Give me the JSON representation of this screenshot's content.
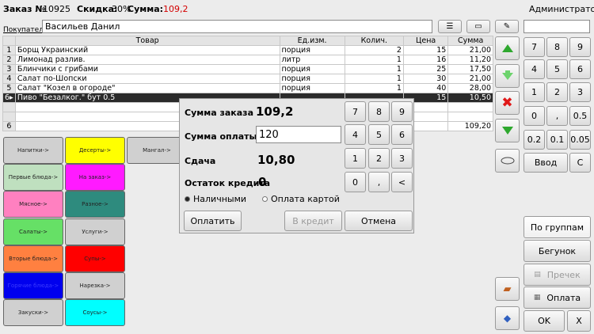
{
  "header": {
    "order_label": "Заказ №",
    "order_no": "10925",
    "discount_label": "Скидка:",
    "discount_value": "30%",
    "sum_label": "Сумма:",
    "sum_value": "109,2",
    "user": "Администратор"
  },
  "buyer": {
    "label": "Покупатель",
    "value": "Васильев Данил"
  },
  "table": {
    "columns": [
      "Товар",
      "Ед.изм.",
      "Колич.",
      "Цена",
      "Сумма"
    ],
    "rows": [
      {
        "n": "1",
        "name": "Борщ Украинский",
        "unit": "порция",
        "qty": "2",
        "price": "15",
        "sum": "21,00"
      },
      {
        "n": "2",
        "name": "Лимонад разлив.",
        "unit": "литр",
        "qty": "1",
        "price": "16",
        "sum": "11,20"
      },
      {
        "n": "3",
        "name": "Блинчики с грибами",
        "unit": "порция",
        "qty": "1",
        "price": "25",
        "sum": "17,50"
      },
      {
        "n": "4",
        "name": "Салат по-Шопски",
        "unit": "порция",
        "qty": "1",
        "price": "30",
        "sum": "21,00"
      },
      {
        "n": "5",
        "name": "Салат \"Козел в огороде\"",
        "unit": "порция",
        "qty": "1",
        "price": "40",
        "sum": "28,00"
      },
      {
        "n": "6",
        "name": "Пиво \"Безалког.\" бут 0.5",
        "unit": "",
        "qty": "",
        "price": "15",
        "sum": "10,50"
      }
    ],
    "footer_count": "6",
    "footer_total": "109,20"
  },
  "categories": [
    {
      "label": "Напитки->",
      "color": "#d0d0d0"
    },
    {
      "label": "Десерты->",
      "color": "#ffff00"
    },
    {
      "label": "Мангал->",
      "color": "#d0d0d0"
    },
    {
      "label": "Первые блюда->",
      "color": "#bfe0bf"
    },
    {
      "label": "На заказ->",
      "color": "#ff1aff"
    },
    {
      "label": "Мясное->",
      "color": "#ff80c0"
    },
    {
      "label": "Разное->",
      "color": "#2e8b7e"
    },
    {
      "label": "Салаты->",
      "color": "#66e066"
    },
    {
      "label": "Услуги->",
      "color": "#d0d0d0"
    },
    {
      "label": "Вторые блюда->",
      "color": "#ff8040"
    },
    {
      "label": "Супы->",
      "color": "#ff0000"
    },
    {
      "label": "Горячие блюда->",
      "color": "#0000ee"
    },
    {
      "label": "Нарезка->",
      "color": "#d0d0d0"
    },
    {
      "label": "Закуски->",
      "color": "#d0d0d0"
    },
    {
      "label": "Соусы->",
      "color": "#00ffff"
    }
  ],
  "payment": {
    "order_sum_label": "Сумма заказа",
    "order_sum": "109,2",
    "paid_label": "Сумма оплаты",
    "paid_value": "120",
    "change_label": "Сдача",
    "change_value": "10,80",
    "credit_label": "Остаток кредита",
    "credit_value": "0",
    "cash_label": "Наличными",
    "card_label": "Оплата картой",
    "pay_btn": "Оплатить",
    "credit_btn": "В кредит",
    "cancel_btn": "Отмена",
    "keys": [
      "7",
      "8",
      "9",
      "4",
      "5",
      "6",
      "1",
      "2",
      "3",
      "0",
      ",",
      "<"
    ]
  },
  "keypad": {
    "keys": [
      "7",
      "8",
      "9",
      "4",
      "5",
      "6",
      "1",
      "2",
      "3",
      "0",
      ",",
      "0.5",
      "0.2",
      "0.1",
      "0.05"
    ],
    "enter": "Ввод",
    "clear": "C"
  },
  "side_buttons": {
    "groups": "По группам",
    "runner": "Бегунок",
    "check": "Пречек",
    "pay": "Оплата",
    "ok": "OK",
    "x": "X"
  }
}
